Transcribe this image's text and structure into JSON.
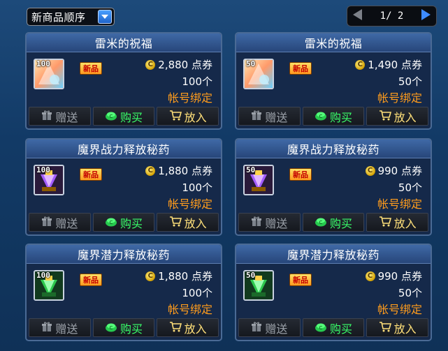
{
  "sort": {
    "label": "新商品顺序"
  },
  "pager": {
    "text": "1/ 2"
  },
  "cards": [
    {
      "title": "雷米的祝福",
      "qty": "100",
      "new": "新品",
      "price": "2,880 点券",
      "count": "100个",
      "bind": "帐号绑定",
      "icon": "remy-blessing-icon",
      "gift": "赠送",
      "buy": "购买",
      "cart": "放入"
    },
    {
      "title": "雷米的祝福",
      "qty": "50",
      "new": "新品",
      "price": "1,490 点券",
      "count": "50个",
      "bind": "帐号绑定",
      "icon": "remy-blessing-icon",
      "gift": "赠送",
      "buy": "购买",
      "cart": "放入"
    },
    {
      "title": "魔界战力释放秘药",
      "qty": "100",
      "new": "新品",
      "price": "1,880 点券",
      "count": "100个",
      "bind": "帐号绑定",
      "icon": "purple-potion-icon",
      "gift": "赠送",
      "buy": "购买",
      "cart": "放入"
    },
    {
      "title": "魔界战力释放秘药",
      "qty": "50",
      "new": "新品",
      "price": "990 点券",
      "count": "50个",
      "bind": "帐号绑定",
      "icon": "purple-potion-icon",
      "gift": "赠送",
      "buy": "购买",
      "cart": "放入"
    },
    {
      "title": "魔界潜力释放秘药",
      "qty": "100",
      "new": "新品",
      "price": "1,880 点券",
      "count": "100个",
      "bind": "帐号绑定",
      "icon": "green-potion-icon",
      "gift": "赠送",
      "buy": "购买",
      "cart": "放入"
    },
    {
      "title": "魔界潜力释放秘药",
      "qty": "50",
      "new": "新品",
      "price": "990 点券",
      "count": "50个",
      "bind": "帐号绑定",
      "icon": "green-potion-icon",
      "gift": "赠送",
      "buy": "购买",
      "cart": "放入"
    }
  ],
  "colors": {
    "bind": "#ff9c1c",
    "buy": "#39ff6a",
    "cart": "#ffe07a",
    "gift": "#9aa0a8"
  }
}
